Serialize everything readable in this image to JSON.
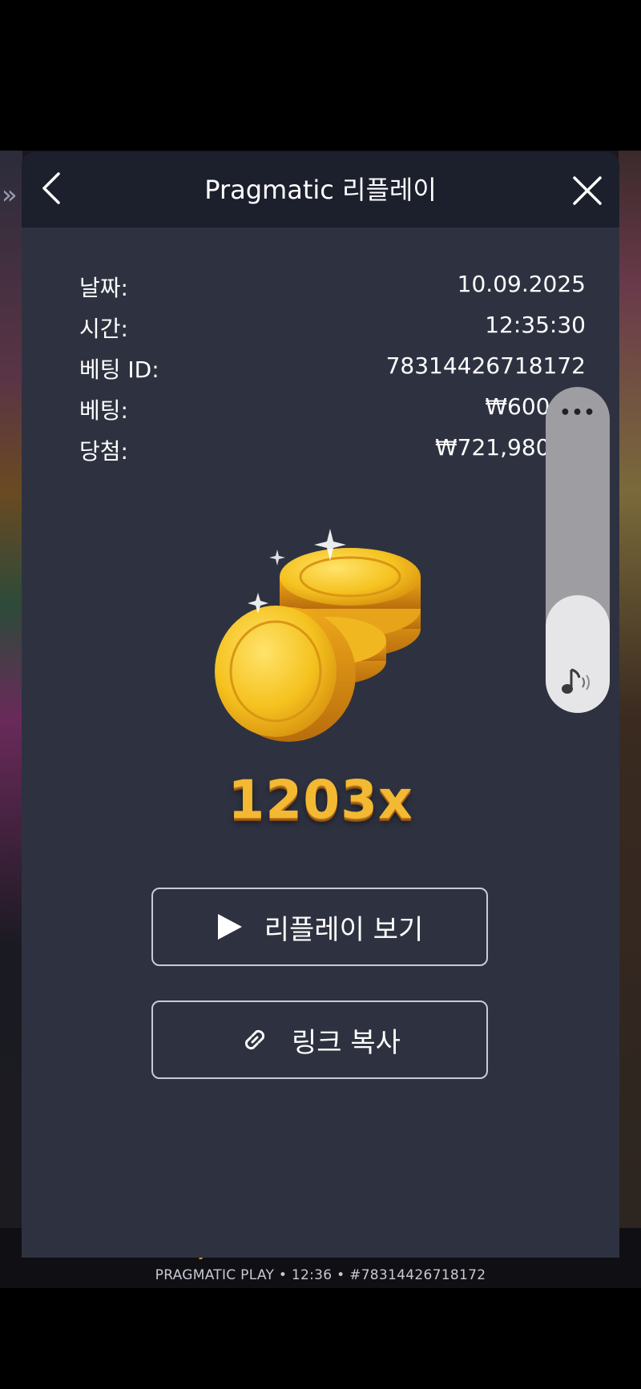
{
  "panel": {
    "title": "Pragmatic 리플레이",
    "back_icon": "chevron-left-icon",
    "close_icon": "close-icon"
  },
  "info": [
    {
      "label": "날짜:",
      "value": "10.09.2025"
    },
    {
      "label": "시간:",
      "value": "12:35:30"
    },
    {
      "label": "베팅 ID:",
      "value": "78314426718172"
    },
    {
      "label": "베팅:",
      "value": "₩600.00"
    },
    {
      "label": "당첨:",
      "value": "₩721,980.00"
    }
  ],
  "multiplier": "1203x",
  "buttons": {
    "replay": {
      "label": "리플레이 보기",
      "icon": "play-icon"
    },
    "copy": {
      "label": "링크 복사",
      "icon": "link-icon"
    }
  },
  "volume": {
    "more_label": "•••",
    "level": 0.36,
    "icon": "music-note-icon"
  },
  "background": {
    "side_chevron": "»",
    "win_text": "₩721,980.00",
    "footer": "PRAGMATIC PLAY • 12:36 • #78314426718172"
  },
  "colors": {
    "panel_bg": "#2e3240",
    "header_bg": "#1c1f2c",
    "gold": "#f3b933"
  }
}
